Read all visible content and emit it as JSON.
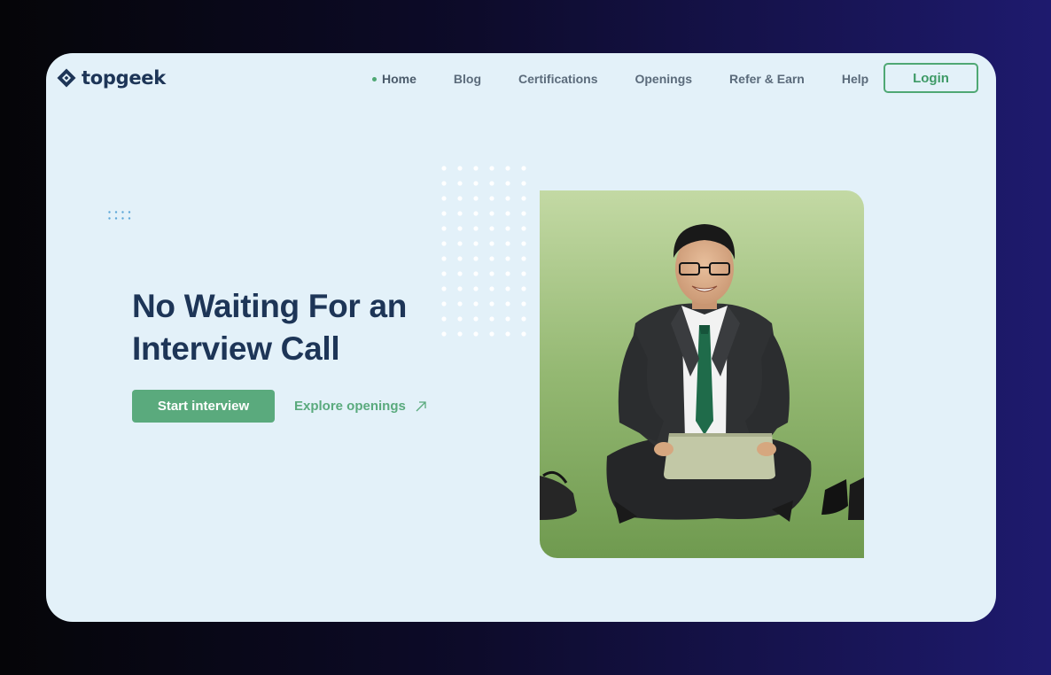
{
  "brand": {
    "name": "topgeek",
    "icon": "diamond-logo-icon"
  },
  "nav": {
    "items": [
      {
        "label": "Home",
        "active": true
      },
      {
        "label": "Blog",
        "active": false
      },
      {
        "label": "Certifications",
        "active": false
      },
      {
        "label": "Openings",
        "active": false
      },
      {
        "label": "Refer & Earn",
        "active": false
      },
      {
        "label": "Help",
        "active": false
      }
    ],
    "login_label": "Login"
  },
  "hero": {
    "title_line1": "No Waiting For an",
    "title_line2": "Interview Call",
    "primary_cta": "Start interview",
    "secondary_cta": "Explore openings",
    "secondary_icon": "arrow-up-right-icon",
    "image": "man-with-laptop-on-grass-photo"
  },
  "colors": {
    "accent": "#5aaa7d",
    "navy": "#1d3557",
    "card_background": "#e3f1f9",
    "page_background": "#0d0b2a"
  }
}
